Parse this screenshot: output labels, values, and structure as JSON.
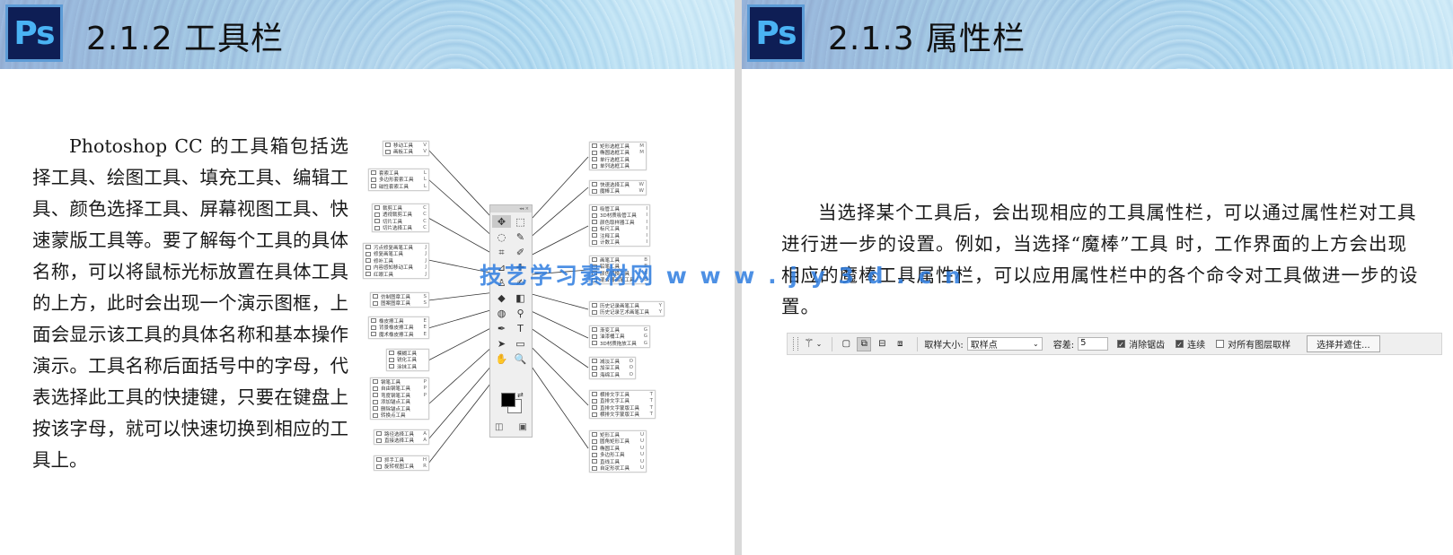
{
  "left_slide": {
    "logo_text": "Ps",
    "section_title": "2.1.2  工具栏",
    "body_text": "Photoshop CC 的工具箱包括选择工具、绘图工具、填充工具、编辑工具、颜色选择工具、屏幕视图工具、快速蒙版工具等。要了解每个工具的具体名称，可以将鼠标光标放置在具体工具的上方，此时会出现一个演示图框，上面会显示该工具的具体名称和基本操作演示。工具名称后面括号中的字母，代表选择此工具的快捷键，只要在键盘上按该字母，就可以快速切换到相应的工具上。"
  },
  "right_slide": {
    "logo_text": "Ps",
    "section_title": "2.1.3  属性栏",
    "body_text": "当选择某个工具后，会出现相应的工具属性栏，可以通过属性栏对工具进行进一步的设置。例如，当选择“魔棒”工具 时，工作界面的上方会出现相应的魔棒工具属性栏，可以应用属性栏中的各个命令对工具做进一步的设置。"
  },
  "watermark": "技艺学习素材网  w w w . j y 3 d . c n",
  "toolbox": {
    "header": "◂◂ ×",
    "tools": [
      "✥",
      "⬚",
      "◌",
      "✎",
      "⌗",
      "✐",
      "⊿",
      "✚",
      "♙",
      "✍",
      "◆",
      "◧",
      "◍",
      "⚲",
      "✒",
      "T",
      "➤",
      "▭",
      "✋",
      "🔍"
    ],
    "swap": "⇄",
    "bottom": [
      "◫",
      "▣"
    ]
  },
  "flyouts_left": [
    {
      "rows": [
        [
          "移动工具",
          "V"
        ],
        [
          "画板工具",
          "V"
        ]
      ]
    },
    {
      "rows": [
        [
          "套索工具",
          "L"
        ],
        [
          "多边形套索工具",
          "L"
        ],
        [
          "磁性套索工具",
          "L"
        ]
      ]
    },
    {
      "rows": [
        [
          "裁剪工具",
          "C"
        ],
        [
          "透视裁剪工具",
          "C"
        ],
        [
          "切片工具",
          "C"
        ],
        [
          "切片选择工具",
          "C"
        ]
      ]
    },
    {
      "rows": [
        [
          "污点修复画笔工具",
          "J"
        ],
        [
          "修复画笔工具",
          "J"
        ],
        [
          "修补工具",
          "J"
        ],
        [
          "内容感知移动工具",
          "J"
        ],
        [
          "红眼工具",
          "J"
        ]
      ]
    },
    {
      "rows": [
        [
          "仿制图章工具",
          "S"
        ],
        [
          "图案图章工具",
          "S"
        ]
      ]
    },
    {
      "rows": [
        [
          "橡皮擦工具",
          "E"
        ],
        [
          "背景橡皮擦工具",
          "E"
        ],
        [
          "魔术橡皮擦工具",
          "E"
        ]
      ]
    },
    {
      "rows": [
        [
          "模糊工具",
          ""
        ],
        [
          "锐化工具",
          ""
        ],
        [
          "涂抹工具",
          ""
        ]
      ]
    },
    {
      "rows": [
        [
          "钢笔工具",
          "P"
        ],
        [
          "自由钢笔工具",
          "P"
        ],
        [
          "弯度钢笔工具",
          "P"
        ],
        [
          "添加锚点工具",
          ""
        ],
        [
          "删除锚点工具",
          ""
        ],
        [
          "转换点工具",
          ""
        ]
      ]
    },
    {
      "rows": [
        [
          "路径选择工具",
          "A"
        ],
        [
          "直接选择工具",
          "A"
        ]
      ]
    },
    {
      "rows": [
        [
          "抓手工具",
          "H"
        ],
        [
          "旋转视图工具",
          "R"
        ]
      ]
    }
  ],
  "flyouts_right": [
    {
      "rows": [
        [
          "矩形选框工具",
          "M"
        ],
        [
          "椭圆选框工具",
          "M"
        ],
        [
          "单行选框工具",
          ""
        ],
        [
          "单列选框工具",
          ""
        ]
      ]
    },
    {
      "rows": [
        [
          "快速选择工具",
          "W"
        ],
        [
          "魔棒工具",
          "W"
        ]
      ]
    },
    {
      "rows": [
        [
          "吸管工具",
          "I"
        ],
        [
          "3D材质吸管工具",
          "I"
        ],
        [
          "颜色取样器工具",
          "I"
        ],
        [
          "标尺工具",
          "I"
        ],
        [
          "注释工具",
          "I"
        ],
        [
          "计数工具",
          "I"
        ]
      ]
    },
    {
      "rows": [
        [
          "画笔工具",
          "B"
        ],
        [
          "铅笔工具",
          "B"
        ],
        [
          "颜色替换工具",
          "B"
        ],
        [
          "混合器画笔工具",
          "B"
        ]
      ]
    },
    {
      "rows": [
        [
          "历史记录画笔工具",
          "Y"
        ],
        [
          "历史记录艺术画笔工具",
          "Y"
        ]
      ]
    },
    {
      "rows": [
        [
          "渐变工具",
          "G"
        ],
        [
          "油漆桶工具",
          "G"
        ],
        [
          "3D材质拖放工具",
          "G"
        ]
      ]
    },
    {
      "rows": [
        [
          "减淡工具",
          "O"
        ],
        [
          "加深工具",
          "O"
        ],
        [
          "海绵工具",
          "O"
        ]
      ]
    },
    {
      "rows": [
        [
          "横排文字工具",
          "T"
        ],
        [
          "直排文字工具",
          "T"
        ],
        [
          "直排文字蒙版工具",
          "T"
        ],
        [
          "横排文字蒙版工具",
          "T"
        ]
      ]
    },
    {
      "rows": [
        [
          "矩形工具",
          "U"
        ],
        [
          "圆角矩形工具",
          "U"
        ],
        [
          "椭圆工具",
          "U"
        ],
        [
          "多边形工具",
          "U"
        ],
        [
          "直线工具",
          "U"
        ],
        [
          "自定形状工具",
          "U"
        ]
      ]
    }
  ],
  "options_bar": {
    "wand_icon": "magic-wand-icon",
    "modes": [
      "▢",
      "⧉",
      "⊟",
      "⧈"
    ],
    "sample_size_label": "取样大小:",
    "sample_size_value": "取样点",
    "tolerance_label": "容差:",
    "tolerance_value": "5",
    "anti_alias_label": "消除锯齿",
    "contiguous_label": "连续",
    "all_layers_label": "对所有图层取样",
    "select_mask_button": "选择并遮住..."
  },
  "colors": {
    "ps_bg": "#0e1e55",
    "ps_text": "#4ab3f4",
    "watermark": "#2e7de0"
  }
}
